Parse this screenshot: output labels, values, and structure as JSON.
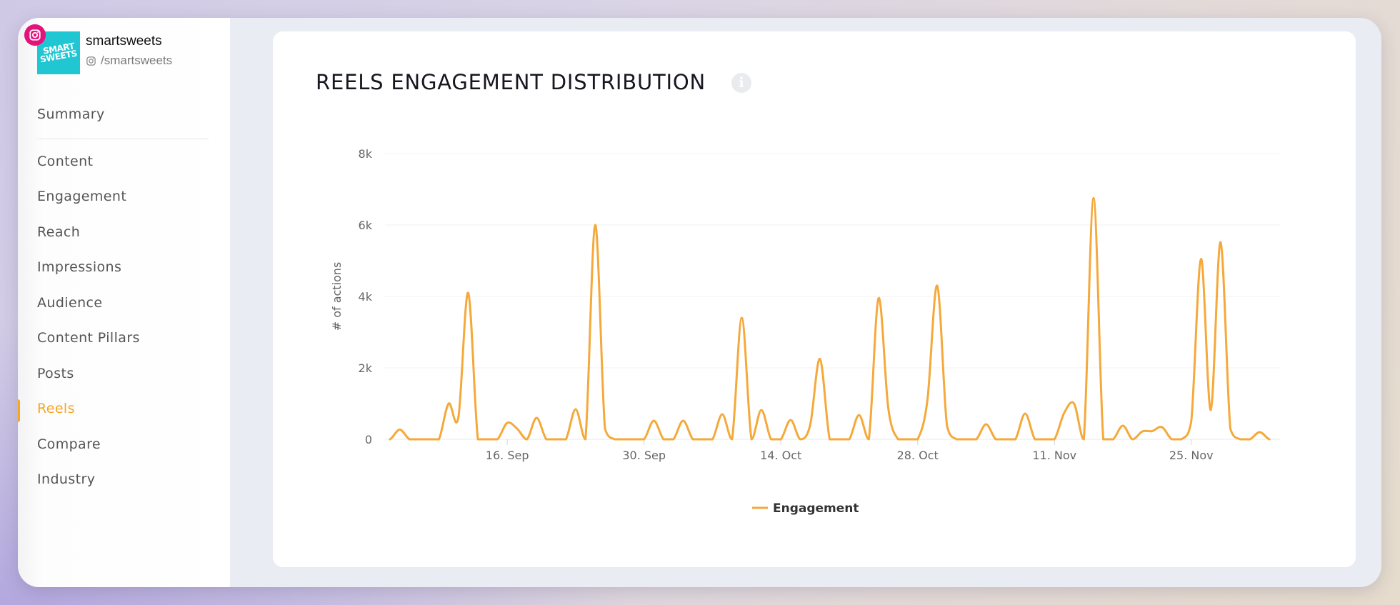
{
  "account": {
    "name": "smartsweets",
    "handle": "/smartsweets",
    "logo_text": [
      "SMART",
      "SWEETS"
    ],
    "platform": "instagram",
    "platform_badge_color": "#e2137a",
    "logo_color": "#21c6d3"
  },
  "sidebar": {
    "items": [
      {
        "label": "Summary",
        "active": false
      },
      {
        "label": "Content",
        "active": false
      },
      {
        "label": "Engagement",
        "active": false
      },
      {
        "label": "Reach",
        "active": false
      },
      {
        "label": "Impressions",
        "active": false
      },
      {
        "label": "Audience",
        "active": false
      },
      {
        "label": "Content Pillars",
        "active": false
      },
      {
        "label": "Posts",
        "active": false
      },
      {
        "label": "Reels",
        "active": true
      },
      {
        "label": "Compare",
        "active": false
      },
      {
        "label": "Industry",
        "active": false
      }
    ],
    "accent_color": "#f5a623"
  },
  "card": {
    "title": "REELS ENGAGEMENT DISTRIBUTION",
    "info_icon": "info-icon"
  },
  "chart_data": {
    "type": "line",
    "title": "REELS ENGAGEMENT DISTRIBUTION",
    "xlabel": "",
    "ylabel": "# of actions",
    "ylim": [
      0,
      8000
    ],
    "yticks": [
      0,
      2000,
      4000,
      6000,
      8000
    ],
    "ytick_labels": [
      "0",
      "2k",
      "4k",
      "6k",
      "8k"
    ],
    "x_start": "4 Sep",
    "x_end": "3 Dec",
    "x_interval": "1 day",
    "xtick_labels": [
      "16. Sep",
      "30. Sep",
      "14. Oct",
      "28. Oct",
      "11. Nov",
      "25. Nov"
    ],
    "xtick_day_index": [
      12,
      26,
      40,
      54,
      68,
      82
    ],
    "grid": true,
    "legend_position": "bottom-center",
    "series": [
      {
        "name": "Engagement",
        "color": "#f5a93a",
        "values": [
          0,
          270,
          0,
          0,
          0,
          0,
          1000,
          620,
          4100,
          0,
          0,
          0,
          460,
          300,
          0,
          600,
          0,
          0,
          0,
          840,
          0,
          6000,
          300,
          0,
          0,
          0,
          0,
          520,
          0,
          0,
          520,
          0,
          0,
          0,
          700,
          0,
          3400,
          0,
          820,
          0,
          0,
          540,
          0,
          400,
          2250,
          0,
          0,
          0,
          680,
          0,
          3950,
          860,
          0,
          0,
          0,
          1100,
          4300,
          380,
          0,
          0,
          0,
          420,
          0,
          0,
          0,
          720,
          0,
          0,
          0,
          740,
          1000,
          0,
          6750,
          0,
          0,
          380,
          0,
          220,
          230,
          340,
          0,
          0,
          500,
          5050,
          820,
          5520,
          300,
          0,
          0,
          200,
          0
        ]
      }
    ]
  }
}
